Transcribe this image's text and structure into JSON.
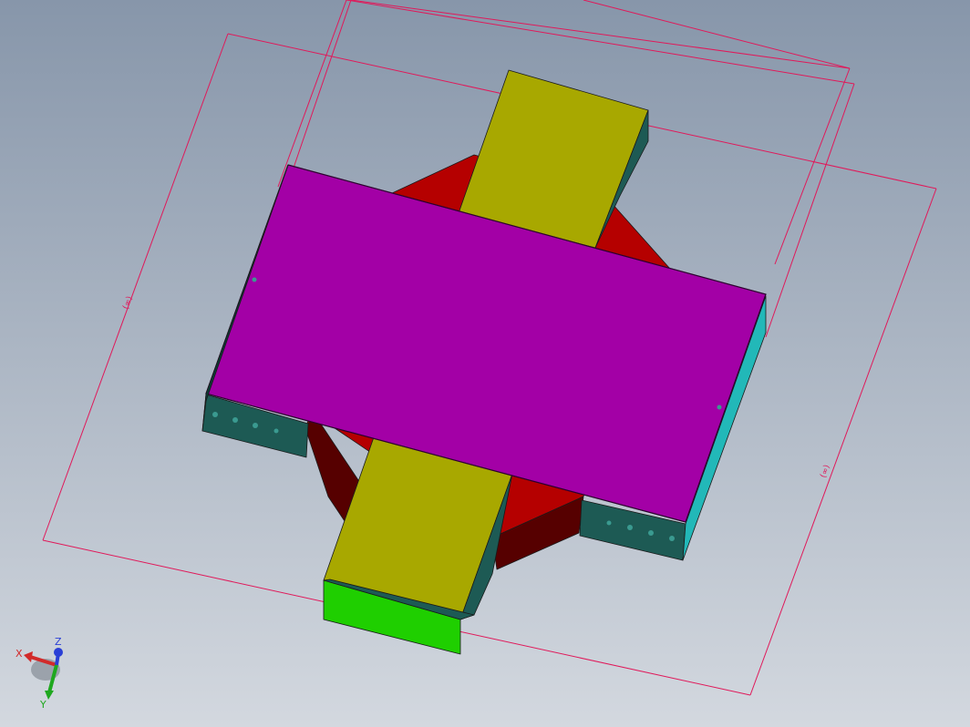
{
  "viewport": {
    "background_top": "#8796aa",
    "background_bottom": "#d3d8df"
  },
  "model": {
    "colors": {
      "top_plate": "#a300a6",
      "top_plate_edge": "#2e0030",
      "branch_top": "#a8a800",
      "octagon": "#b50000",
      "octagon_dark": "#560000",
      "side_wall": "#1d5a54",
      "side_wall_dark": "#0d3a36",
      "side_right": "#22b8b8",
      "end_cap": "#1fcf00",
      "hole": "#3a9a90"
    }
  },
  "dimensions": {
    "color": "#e0195a",
    "labels": [
      "(∞)",
      "(∞)"
    ]
  },
  "triad": {
    "x_label": "X",
    "y_label": "Y",
    "z_label": "Z",
    "x_color": "#d22a2a",
    "y_color": "#1fa81f",
    "z_color": "#2a3fd6"
  }
}
